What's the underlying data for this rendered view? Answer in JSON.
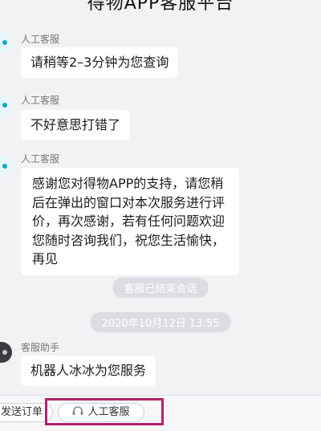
{
  "header": {
    "title": "得物APP客服平台"
  },
  "messages": [
    {
      "sender": "人工客服",
      "text": "请稍等2–3分钟为您查询"
    },
    {
      "sender": "人工客服",
      "text": "不好意思打错了"
    },
    {
      "sender": "人工客服",
      "text": "感谢您对得物APP的支持，请您稍后在弹出的窗口对本次服务进行评价，再次感谢，若有任何问题欢迎您随时咨询我们，祝您生活愉快，再见"
    }
  ],
  "system": {
    "session_ended": "客服已结束会话",
    "timestamp": "2020年10月12日 13:55"
  },
  "assistant_message": {
    "sender": "客服助手",
    "text": "机器人冰冰为您服务"
  },
  "bottom_bar": {
    "send_order_label": "发送订单",
    "human_agent_label": "人工客服"
  },
  "colors": {
    "background": "#f2f2f5",
    "bubble": "#ffffff",
    "pill": "#dcdce2",
    "avatar_accent": "#14a7c4",
    "highlight_box": "#b3236c"
  },
  "icons": {
    "agent_avatar": "agent-avatar-icon",
    "assistant_avatar": "assistant-avatar-icon",
    "human_agent": "headset-icon"
  }
}
